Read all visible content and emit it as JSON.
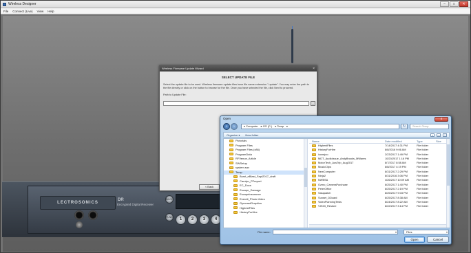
{
  "app": {
    "title": "Wireless Designer",
    "menu": [
      "File",
      "Connect (Live)",
      "View",
      "Help"
    ],
    "window_buttons": [
      "–",
      "□",
      "✕"
    ]
  },
  "device": {
    "brand": "LECTROSONICS",
    "model_name": "DR",
    "model_desc": "Encrypted Digital Receiver",
    "buttons": {
      "back": "BACK",
      "func": "FUNC"
    },
    "number_buttons": [
      "1",
      "2",
      "3",
      "4"
    ]
  },
  "wizard": {
    "title": "Wireless Firmware Update Wizard",
    "close": "×",
    "heading": "SELECT UPDATE FILE",
    "instructions": "Select the update file to be used. Wireless firmware update files have file name extension \".update\". You may enter the path to the file directly or click on the button to browse for the file. Once you have selected the file, click Next to proceed.",
    "path_label": "Path to Update File:",
    "path_value": "",
    "browse_label": "...",
    "back_button": "< Back"
  },
  "open_dialog": {
    "title": "Open",
    "close": "x",
    "breadcrumb": [
      "▸ Computer",
      "▸ OS (C:)",
      "▸ Temp",
      "▸"
    ],
    "search_placeholder": "Search Temp",
    "toolbar": {
      "organize": "Organize ▾",
      "new_folder": "New folder"
    },
    "toolbar_icons": [
      "views-icon",
      "preview-pane-icon",
      "help-icon"
    ],
    "tree": [
      "Pictorials",
      "Program Files",
      "Program Files (x86)",
      "ProgramData",
      "RFVenue_Article",
      "SWSetup",
      "system.sav",
      "Temp",
      "Burst_eBlast_Sept2017_draft",
      "Carolyn_PFreport",
      "EC_Docs",
      "Escape_Damage",
      "EscapeInsurance",
      "Everett_Photo-Video",
      "GymnastGraphics",
      "HighestFiles",
      "HistoryForHire"
    ],
    "tree_selected_index": 7,
    "columns": [
      "Name",
      "Date modified",
      "Type",
      "Size"
    ],
    "files": [
      {
        "name": "HighestFiles",
        "date": "7/14/2017 4:31 PM",
        "type": "File folder"
      },
      {
        "name": "HistoryForHire",
        "date": "8/8/2016 9:06 AM",
        "type": "File folder"
      },
      {
        "name": "iconejoo",
        "date": "2/23/2017 1:49 PM",
        "type": "File folder"
      },
      {
        "name": "MDT_AudioIssue_AndyBrooks_MWares",
        "date": "10/20/2017 1:16 PM",
        "type": "File folder"
      },
      {
        "name": "MotorTech_AosTrip_Aug2017",
        "date": "8/7/2017 8:58 AM",
        "type": "File folder"
      },
      {
        "name": "MusicClips",
        "date": "8/8/2017 4:19 PM",
        "type": "File folder"
      },
      {
        "name": "NewComputer",
        "date": "8/31/2017 2:29 PM",
        "type": "File folder"
      },
      {
        "name": "Ninja2",
        "date": "8/31/2016 3:06 PM",
        "type": "File folder"
      },
      {
        "name": "NWBSA",
        "date": "4/26/2017 10:09 AM",
        "type": "File folder"
      },
      {
        "name": "Ozmo_CameraPurchase",
        "date": "8/25/2017 1:40 PM",
        "type": "File folder"
      },
      {
        "name": "PeterOffice",
        "date": "8/25/2017 2:19 PM",
        "type": "File folder"
      },
      {
        "name": "Sasquatch",
        "date": "8/25/2017 9:03 PM",
        "type": "File folder"
      },
      {
        "name": "Sunset_DDcard",
        "date": "8/25/2017 8:38 AM",
        "type": "File folder"
      },
      {
        "name": "VideoPlanningTests",
        "date": "8/24/2017 8:22 AM",
        "type": "File folder"
      },
      {
        "name": "VIH43_Restore",
        "date": "8/22/2017 3:14 PM",
        "type": "File folder"
      }
    ],
    "file_name_label": "File name:",
    "file_name_value": "",
    "filter": "Files",
    "open_button": "Open",
    "cancel_button": "Cancel"
  }
}
